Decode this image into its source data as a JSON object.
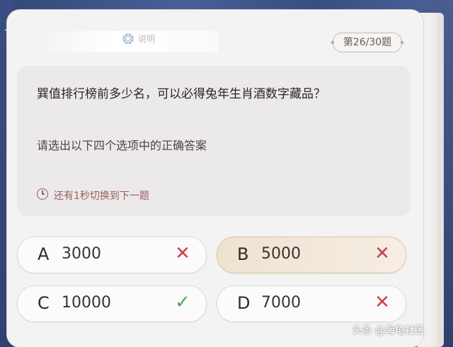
{
  "header": {
    "hint_text": "说明",
    "progress": "第26/30题"
  },
  "question": {
    "text": "巽值排行榜前多少名，可以必得兔年生肖酒数字藏品？",
    "instruction": "请选出以下四个选项中的正确答案",
    "timer_text": "还有1秒切换到下一题"
  },
  "options": [
    {
      "letter": "A",
      "value": "3000",
      "result": "wrong",
      "result_icon": "cross-icon"
    },
    {
      "letter": "B",
      "value": "5000",
      "result": "wrong",
      "result_icon": "cross-icon",
      "selected": true
    },
    {
      "letter": "C",
      "value": "10000",
      "result": "correct",
      "result_icon": "check-icon"
    },
    {
      "letter": "D",
      "value": "7000",
      "result": "wrong",
      "result_icon": "cross-icon"
    }
  ],
  "watermark": "头条 @海龟社区",
  "colors": {
    "wrong": "#c8434b",
    "correct": "#4fa85a",
    "selected_bg": "#f3e9dc",
    "timer": "#9a5c60"
  }
}
